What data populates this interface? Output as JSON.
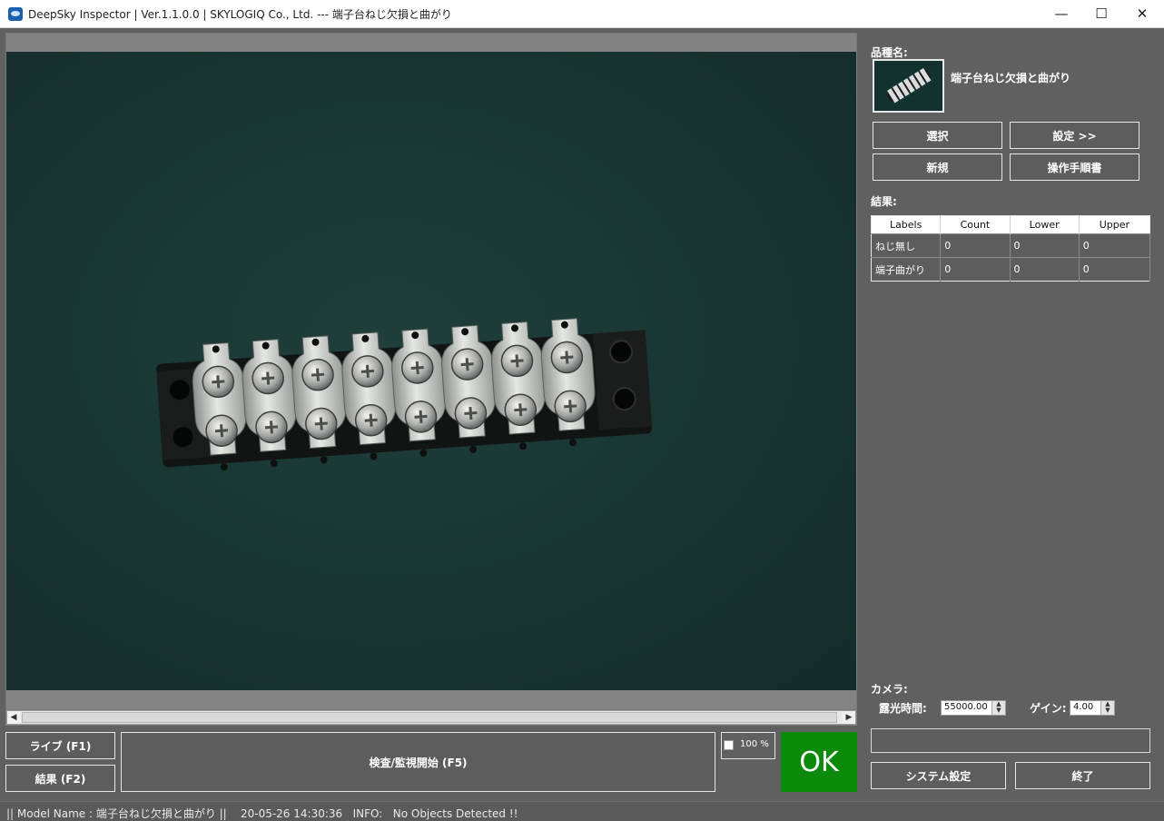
{
  "window": {
    "title": "DeepSky Inspector | Ver.1.1.0.0 | SKYLOGIQ Co., Ltd. --- 端子台ねじ欠損と曲がり",
    "minimize_glyph": "—",
    "maximize_glyph": "☐",
    "close_glyph": "✕"
  },
  "viewer": {
    "scroll_left_glyph": "◀",
    "scroll_right_glyph": "▶"
  },
  "controls": {
    "live_label": "ライブ (F1)",
    "result_label": "結果 (F2)",
    "inspect_label": "検査/監視開始 (F5)",
    "zoom_label": "100 %",
    "verdict": "OK",
    "verdict_color": "#0b8a0b"
  },
  "panel": {
    "product_label": "品種名:",
    "product_name": "端子台ねじ欠損と曲がり",
    "select_label": "選択",
    "settings_label": "設定 >>",
    "new_label": "新規",
    "manual_label": "操作手順書",
    "results_label": "結果:",
    "table": {
      "headers": [
        "Labels",
        "Count",
        "Lower",
        "Upper"
      ],
      "rows": [
        [
          "ねじ無し",
          "0",
          "0",
          "0"
        ],
        [
          "端子曲がり",
          "0",
          "0",
          "0"
        ]
      ]
    },
    "camera_label": "カメラ:",
    "exposure_label": "露光時間:",
    "exposure_value": "55000.00",
    "gain_label": "ゲイン:",
    "gain_value": "4.00",
    "system_settings_label": "システム設定",
    "exit_label": "終了"
  },
  "status": {
    "text": "|| Model Name : 端子台ねじ欠損と曲がり ||    20-05-26 14:30:36   INFO:   No Objects Detected !!"
  }
}
